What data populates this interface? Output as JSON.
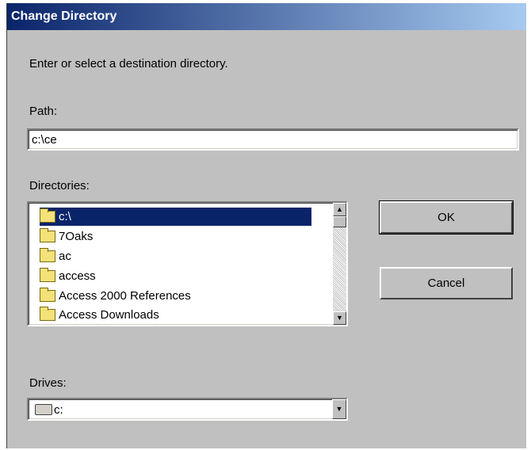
{
  "dialog": {
    "title": "Change Directory",
    "instruction": "Enter or select a destination directory.",
    "path_label": "Path:",
    "path_value": "c:\\ce",
    "directories_label": "Directories:",
    "drives_label": "Drives:"
  },
  "directories": {
    "selected": "c:\\",
    "items": [
      "7Oaks",
      "ac",
      "access",
      "Access 2000 References",
      "Access Downloads"
    ]
  },
  "drives": {
    "selected": "c:"
  },
  "buttons": {
    "ok": "OK",
    "cancel": "Cancel"
  },
  "colors": {
    "selection": "#0a246a",
    "dialog_bg": "#c0c0c0"
  }
}
